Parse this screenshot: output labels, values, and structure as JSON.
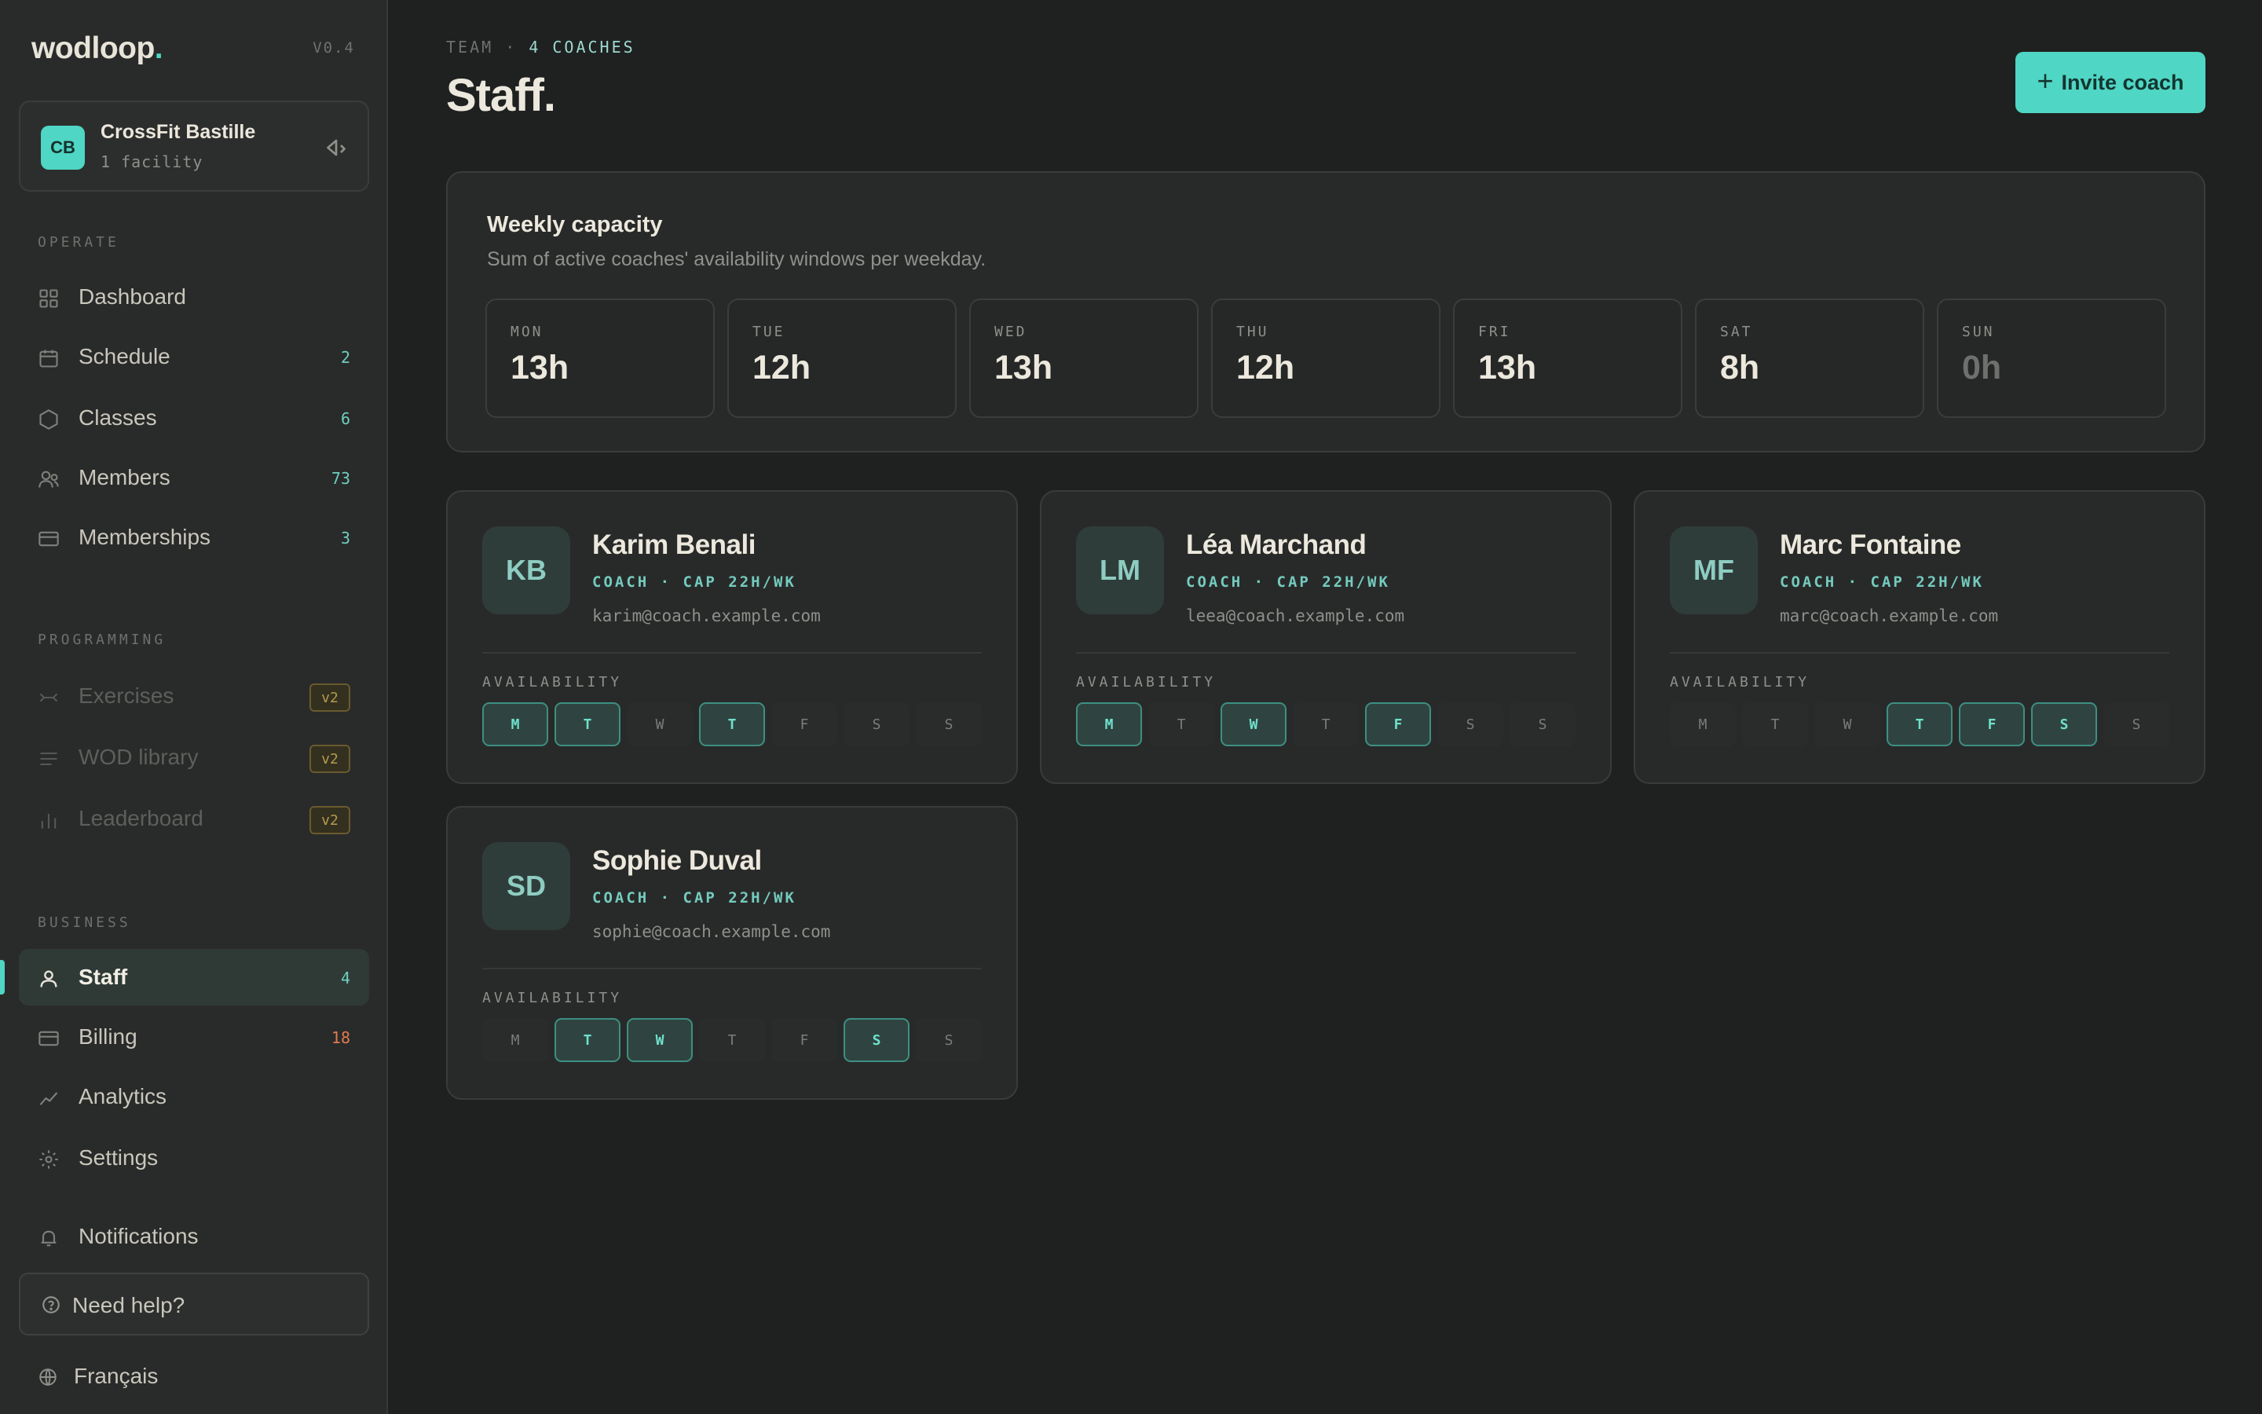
{
  "brand": {
    "name": "wodloop",
    "dot": ".",
    "version": "V0.4"
  },
  "facility": {
    "initials": "CB",
    "name": "CrossFit Bastille",
    "sub": "1 facility"
  },
  "sections": {
    "operate": "OPERATE",
    "programming": "PROGRAMMING",
    "business": "BUSINESS"
  },
  "nav": {
    "dashboard": {
      "label": "Dashboard"
    },
    "schedule": {
      "label": "Schedule",
      "count": "2"
    },
    "classes": {
      "label": "Classes",
      "count": "6"
    },
    "members": {
      "label": "Members",
      "count": "73"
    },
    "memberships": {
      "label": "Memberships",
      "count": "3"
    },
    "exercises": {
      "label": "Exercises",
      "tag": "v2"
    },
    "wod_library": {
      "label": "WOD library",
      "tag": "v2"
    },
    "leaderboard": {
      "label": "Leaderboard",
      "tag": "v2"
    },
    "staff": {
      "label": "Staff",
      "count": "4"
    },
    "billing": {
      "label": "Billing",
      "count": "18"
    },
    "analytics": {
      "label": "Analytics"
    },
    "settings": {
      "label": "Settings"
    },
    "notifications": {
      "label": "Notifications"
    }
  },
  "help": {
    "label": "Need help?"
  },
  "language": {
    "label": "Français"
  },
  "header": {
    "crumb_prefix": "TEAM",
    "crumb_sep": "·",
    "crumb_strong": "4 COACHES",
    "title": "Staff.",
    "invite_label": "Invite coach"
  },
  "capacity": {
    "title": "Weekly capacity",
    "subtitle": "Sum of active coaches' availability windows per weekday.",
    "days": [
      {
        "name": "MON",
        "value": "13h"
      },
      {
        "name": "TUE",
        "value": "12h"
      },
      {
        "name": "WED",
        "value": "13h"
      },
      {
        "name": "THU",
        "value": "12h"
      },
      {
        "name": "FRI",
        "value": "13h"
      },
      {
        "name": "SAT",
        "value": "8h"
      },
      {
        "name": "SUN",
        "value": "0h"
      }
    ]
  },
  "availability_label": "AVAILABILITY",
  "coaches": [
    {
      "initials": "KB",
      "name": "Karim Benali",
      "role": "COACH · CAP 22H/WK",
      "email": "karim@coach.example.com",
      "days": [
        [
          "M",
          true
        ],
        [
          "T",
          true
        ],
        [
          "W",
          false
        ],
        [
          "T",
          true
        ],
        [
          "F",
          false
        ],
        [
          "S",
          false
        ],
        [
          "S",
          false
        ]
      ]
    },
    {
      "initials": "LM",
      "name": "Léa Marchand",
      "role": "COACH · CAP 22H/WK",
      "email": "leea@coach.example.com",
      "days": [
        [
          "M",
          true
        ],
        [
          "T",
          false
        ],
        [
          "W",
          true
        ],
        [
          "T",
          false
        ],
        [
          "F",
          true
        ],
        [
          "S",
          false
        ],
        [
          "S",
          false
        ]
      ]
    },
    {
      "initials": "MF",
      "name": "Marc Fontaine",
      "role": "COACH · CAP 22H/WK",
      "email": "marc@coach.example.com",
      "days": [
        [
          "M",
          false
        ],
        [
          "T",
          false
        ],
        [
          "W",
          false
        ],
        [
          "T",
          true
        ],
        [
          "F",
          true
        ],
        [
          "S",
          true
        ],
        [
          "S",
          false
        ]
      ]
    },
    {
      "initials": "SD",
      "name": "Sophie Duval",
      "role": "COACH · CAP 22H/WK",
      "email": "sophie@coach.example.com",
      "days": [
        [
          "M",
          false
        ],
        [
          "T",
          true
        ],
        [
          "W",
          true
        ],
        [
          "T",
          false
        ],
        [
          "F",
          false
        ],
        [
          "S",
          true
        ],
        [
          "S",
          false
        ]
      ]
    }
  ],
  "colors": {
    "accent": "#4fd6c4",
    "background": "#1f2120",
    "sidebar": "#292b2a",
    "warning": "#e07a4f"
  }
}
